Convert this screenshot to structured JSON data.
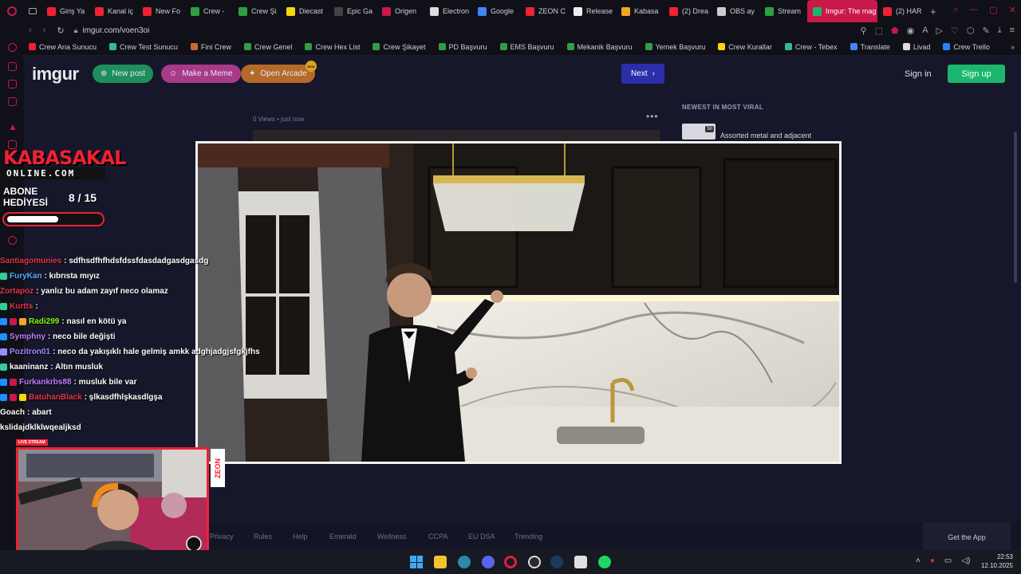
{
  "browser": {
    "tabs": [
      {
        "label": "Giriş Ya",
        "color": "#e23"
      },
      {
        "label": "Kanal iç",
        "color": "#e23"
      },
      {
        "label": "New Fo",
        "color": "#e23"
      },
      {
        "label": "Crew -",
        "color": "#2ea043"
      },
      {
        "label": "Crew Şi",
        "color": "#2ea043"
      },
      {
        "label": "Diecast",
        "color": "#f5d90a"
      },
      {
        "label": "Epic Ga",
        "color": "#444"
      },
      {
        "label": "Origen",
        "color": "#c9184a"
      },
      {
        "label": "Electron",
        "color": "#ddd"
      },
      {
        "label": "Google",
        "color": "#4285f4"
      },
      {
        "label": "ZEON C",
        "color": "#e23"
      },
      {
        "label": "Release",
        "color": "#eee"
      },
      {
        "label": "Kabasa",
        "color": "#f5a623"
      },
      {
        "label": "(2) Drea",
        "color": "#e23"
      },
      {
        "label": "OBS ay",
        "color": "#ccc"
      },
      {
        "label": "Stream",
        "color": "#2ea043"
      },
      {
        "label": "Imgur: The mag",
        "color": "#1bb76e",
        "active": true
      },
      {
        "label": "(2) HAR",
        "color": "#e23"
      }
    ],
    "new_tab": "+",
    "url": "imgur.com/voen3oi",
    "bookmarks": [
      {
        "label": "Crew Ana Sunucu",
        "color": "#e23"
      },
      {
        "label": "Crew Test Sunucu",
        "color": "#3b9"
      },
      {
        "label": "Fini Crew",
        "color": "#c63"
      },
      {
        "label": "Crew Genel",
        "color": "#2ea043"
      },
      {
        "label": "Crew Hex List",
        "color": "#2ea043"
      },
      {
        "label": "Crew Şikayet",
        "color": "#2ea043"
      },
      {
        "label": "PD Başvuru",
        "color": "#2ea043"
      },
      {
        "label": "EMS Başvuru",
        "color": "#2ea043"
      },
      {
        "label": "Mekanik Başvuru",
        "color": "#2ea043"
      },
      {
        "label": "Yemek Başvuru",
        "color": "#2ea043"
      },
      {
        "label": "Crew Kurallar",
        "color": "#f5d90a"
      },
      {
        "label": "Crew - Tebex",
        "color": "#3b9"
      },
      {
        "label": "Translate",
        "color": "#4285f4"
      },
      {
        "label": "Livad",
        "color": "#ddd"
      },
      {
        "label": "Crew Trello",
        "color": "#2684ff"
      }
    ]
  },
  "imgur": {
    "logo": "imgur",
    "new_post": "New post",
    "make_meme": "Make a Meme",
    "open_arcade": "Open Arcade",
    "arcade_badge": "NEW",
    "next": "Next",
    "sign_in": "Sign in",
    "sign_up": "Sign up",
    "views": "0 Views • just now",
    "more": "•••",
    "viral_heading": "NEWEST IN MOST VIRAL",
    "viral_item_title": "Assorted metal and adjacent",
    "viral_item_badge": "50",
    "footer": [
      "Privacy",
      "Rules",
      "Help",
      "Emerald",
      "Wellness",
      "CCPA",
      "EU DSA",
      "Trending"
    ],
    "get_app": "Get the App"
  },
  "overlay": {
    "brand": "KABASAKAL",
    "brand_sub": "ONLINE.COM",
    "abone_line1": "ABONE",
    "abone_line2": "HEDİYESİ",
    "abone_count": "8  / 15",
    "abone_progress": 0.53,
    "live_label": "LIVE STREAM",
    "sponsor": "ZEON"
  },
  "chat": [
    {
      "user": "Santiagomunies",
      "color": "#e2364a",
      "text": ": sdfhsdfhfhdsfdssfdasdadgasdgasdg",
      "badges": []
    },
    {
      "user": "FuryKan",
      "color": "#5aa9ff",
      "text": ": kıbrısta mıyız",
      "badges": [
        "#3c9"
      ]
    },
    {
      "user": "Zortapoz",
      "color": "#e2364a",
      "text": ": yanlız bu adam zayıf neco olamaz",
      "badges": []
    },
    {
      "user": "Kurtts",
      "color": "#e2364a",
      "text": ":",
      "badges": [
        "#3c9"
      ]
    },
    {
      "user": "Radi299",
      "color": "#7cfc00",
      "text": ": nasıl en kötü ya",
      "badges": [
        "#1e90ff",
        "#c9184a",
        "#f5a623"
      ]
    },
    {
      "user": "Symphny",
      "color": "#c27cff",
      "text": ": neco bile değişti",
      "badges": [
        "#1e90ff"
      ]
    },
    {
      "user": "Pozitron01",
      "color": "#9b8cff",
      "text": ": neco da yakışıklı hale gelmiş amkk adghjadgjsfgkjfhs",
      "badges": [
        "#9b8cff"
      ]
    },
    {
      "user": "kaaninanz",
      "color": "#ffffff",
      "text": ": Altın musluk",
      "badges": [
        "#3c9"
      ]
    },
    {
      "user": "Furkankrbs88",
      "color": "#c27cff",
      "text": ": musluk bile var",
      "badges": [
        "#1e90ff",
        "#c9184a"
      ]
    },
    {
      "user": "BatuhanBlack",
      "color": "#e2364a",
      "text": ": şlkasdfhlşkasdlgşa",
      "badges": [
        "#1e90ff",
        "#c9184a",
        "#f5d90a"
      ]
    },
    {
      "user": "Goach",
      "color": "#ffffff",
      "text": ": abart",
      "badges": []
    },
    {
      "user": "",
      "color": "#ffffff",
      "text": "kslidajdklklwqealjksd",
      "badges": []
    }
  ],
  "system": {
    "time": "22:53",
    "date": "12.10.2025"
  }
}
